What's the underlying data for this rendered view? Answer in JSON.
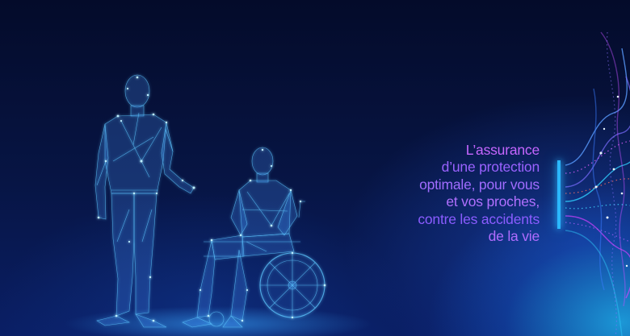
{
  "banner": {
    "tagline_lines": [
      "L’assurance",
      "d’une protection",
      "optimale, pour vous",
      "et vos proches,",
      "contre les accidents",
      "de la vie"
    ]
  },
  "illustration": {
    "subjects": [
      "standing-person",
      "person-in-wheelchair"
    ],
    "style": "low-poly wireframe with glowing nodes"
  },
  "colors": {
    "background": "#040c2e",
    "wireframe": "#5fc8ff",
    "node_glow": "#bff0ff",
    "text_purple": "#b56cff",
    "text_violet": "#8a5cff",
    "accent_bar": "#2bb8ff",
    "wave_magenta": "#d040ff",
    "wave_cyan": "#30d0ff"
  }
}
